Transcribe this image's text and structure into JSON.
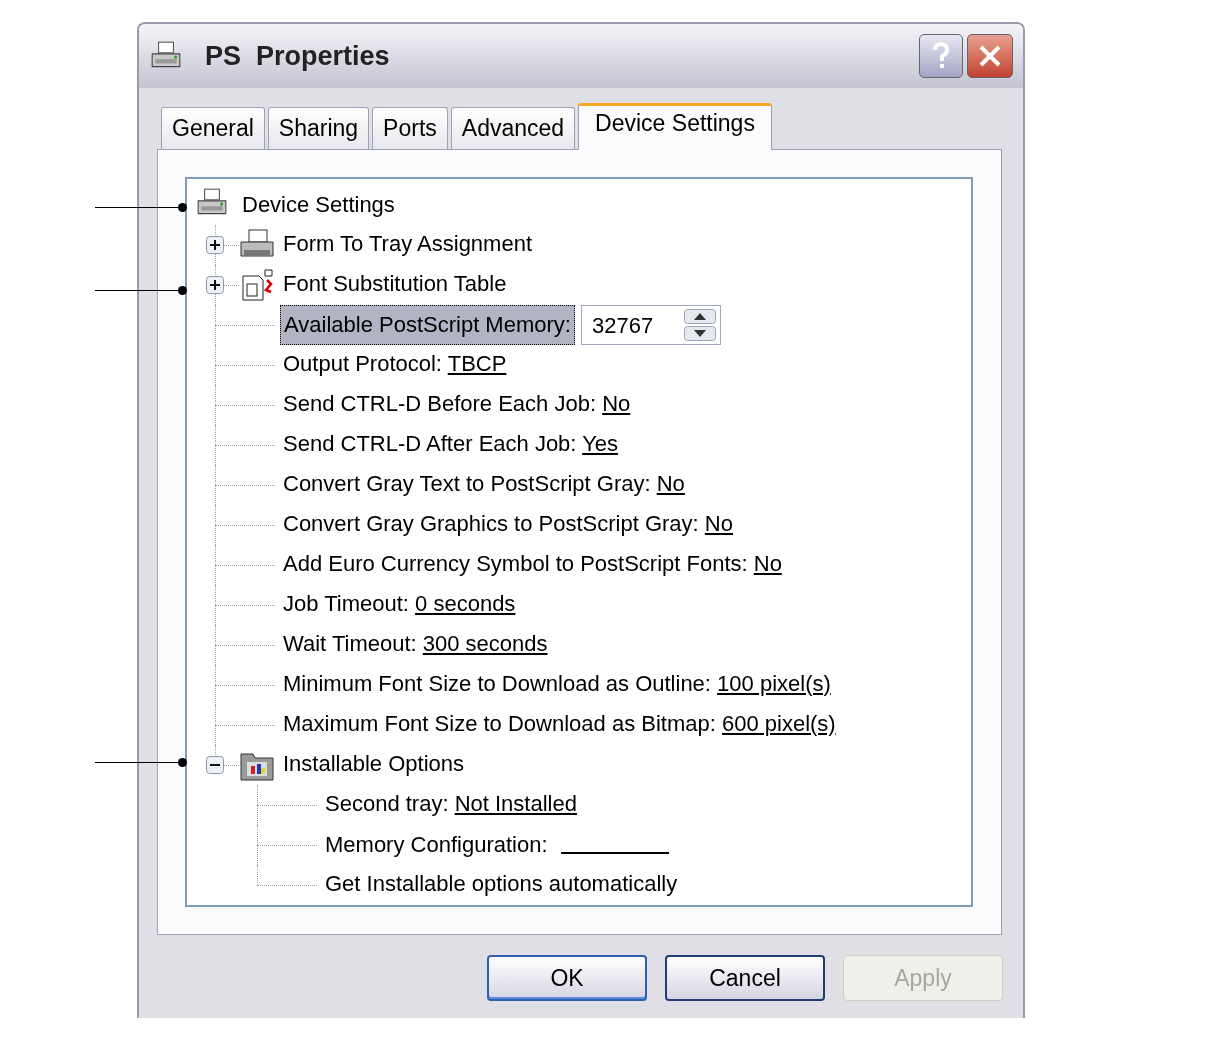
{
  "window": {
    "title": "PS  Properties"
  },
  "tabs": [
    {
      "label": "General",
      "selected": false
    },
    {
      "label": "Sharing",
      "selected": false
    },
    {
      "label": "Ports",
      "selected": false
    },
    {
      "label": "Advanced",
      "selected": false
    },
    {
      "label": "Device Settings",
      "selected": true
    }
  ],
  "tree": {
    "label": "Device Settings",
    "selected": false,
    "children": [
      {
        "kind": "group",
        "label": "Form To Tray Assignment",
        "expanded": false,
        "selected": false
      },
      {
        "kind": "group",
        "label": "Font Substitution Table",
        "expanded": false,
        "selected": false
      },
      {
        "kind": "spin",
        "label": "Available PostScript Memory:",
        "value": "32767",
        "selected": true
      },
      {
        "kind": "setting",
        "label": "Output Protocol:",
        "value": "TBCP",
        "selected": false
      },
      {
        "kind": "setting",
        "label": "Send CTRL-D Before Each Job:",
        "value": "No",
        "selected": false
      },
      {
        "kind": "setting",
        "label": "Send CTRL-D After Each Job:",
        "value": "Yes",
        "selected": false
      },
      {
        "kind": "setting",
        "label": "Convert Gray Text to PostScript Gray:",
        "value": "No",
        "selected": false
      },
      {
        "kind": "setting",
        "label": "Convert Gray Graphics to PostScript Gray:",
        "value": "No",
        "selected": false
      },
      {
        "kind": "setting",
        "label": "Add Euro Currency Symbol to PostScript Fonts:",
        "value": "No",
        "selected": false
      },
      {
        "kind": "setting",
        "label": "Job Timeout:",
        "value": "0 seconds",
        "selected": false
      },
      {
        "kind": "setting",
        "label": "Wait Timeout:",
        "value": "300 seconds",
        "selected": false
      },
      {
        "kind": "setting",
        "label": "Minimum Font Size to Download as Outline:",
        "value": "100 pixel(s)",
        "selected": false
      },
      {
        "kind": "setting",
        "label": "Maximum Font Size to Download as Bitmap:",
        "value": "600 pixel(s)",
        "selected": false
      },
      {
        "kind": "group",
        "label": "Installable Options",
        "expanded": true,
        "selected": false,
        "children": [
          {
            "kind": "setting",
            "label": "Second tray:",
            "value": "Not Installed",
            "selected": false
          },
          {
            "kind": "blank",
            "label": "Memory Configuration:",
            "selected": false
          },
          {
            "kind": "plain",
            "label": "Get Installable options automatically",
            "selected": false
          }
        ]
      }
    ]
  },
  "buttons": [
    {
      "label": "OK",
      "disabled": false,
      "default": true
    },
    {
      "label": "Cancel",
      "disabled": false,
      "default": false
    },
    {
      "label": "Apply",
      "disabled": true,
      "default": false
    }
  ]
}
